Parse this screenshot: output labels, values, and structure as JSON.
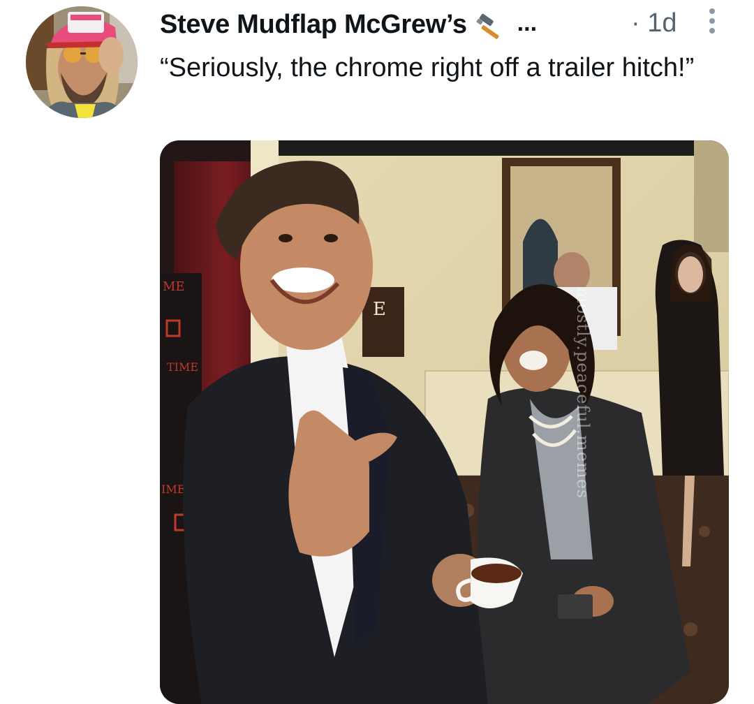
{
  "tweet": {
    "author": {
      "display_name": "Steve Mudflap McGrew’s",
      "name_emoji": "hammer-icon",
      "truncation": "...",
      "avatar": "avatar"
    },
    "timestamp": "· 1d",
    "more_icon": "more-vertical-icon",
    "text": "“Seriously, the chrome right off a trailer hitch!”",
    "media": {
      "watermark": "mostly.peaceful.memes",
      "background_text": [
        "ME",
        "TIME",
        "IME",
        "E"
      ]
    }
  }
}
